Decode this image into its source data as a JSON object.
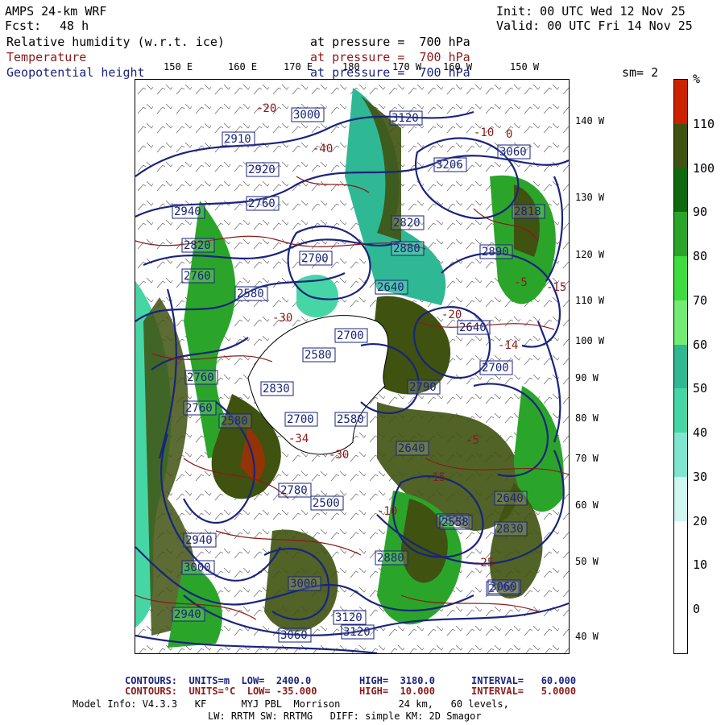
{
  "header": {
    "model": "AMPS 24-km WRF",
    "fcst_label": "Fcst:",
    "fcst_value": "48 h",
    "init": "Init: 00 UTC Wed 12 Nov 25",
    "valid": "Valid: 00 UTC Fri 14 Nov 25"
  },
  "fields": [
    {
      "name": "Relative humidity (w.r.t. ice)",
      "level": "at pressure =  700 hPa",
      "color": "#000000"
    },
    {
      "name": "Temperature",
      "level": "at pressure =  700 hPa",
      "color": "#8b1a1a"
    },
    {
      "name": "Geopotential height",
      "level": "at pressure =  700 hPa",
      "color": "#1a237e"
    }
  ],
  "smoothing": "sm= 2",
  "lon_labels": [
    "150 E",
    "160 E",
    "170 E",
    "180",
    "170 W",
    "160 W",
    "150 W"
  ],
  "lat_labels": [
    "140 W",
    "130 W",
    "120 W",
    "110 W",
    "100 W",
    "90 W",
    "80 W",
    "70 W",
    "60 W",
    "50 W",
    "40 W"
  ],
  "legend": {
    "unit": "%",
    "labels": [
      "110",
      "100",
      "90",
      "80",
      "70",
      "60",
      "50",
      "40",
      "30",
      "20",
      "10",
      "0"
    ],
    "colors": [
      "#cc2200",
      "#3f5210",
      "#0d6b0d",
      "#2aa52a",
      "#3fdc3f",
      "#73ec73",
      "#2fb894",
      "#46d6a6",
      "#7ee6d0",
      "#cff7f0",
      "#ffffff",
      "#ffffff",
      "#ffffff"
    ]
  },
  "map": {
    "height_labels": [
      "3000",
      "3120",
      "2910",
      "2920",
      "3206",
      "3060",
      "2940",
      "2760",
      "2818",
      "2820",
      "2880",
      "2890",
      "2700",
      "2820",
      "2640",
      "2580",
      "2760",
      "2700",
      "2580",
      "2640",
      "2760",
      "2830",
      "2790",
      "2700",
      "2580",
      "2580",
      "2640",
      "2700",
      "2760",
      "2780",
      "2500",
      "2820",
      "2640",
      "2558",
      "2830",
      "2940",
      "2700",
      "2880",
      "3000",
      "3000",
      "2940",
      "3060",
      "3120",
      "3060",
      "3120"
    ],
    "temp_labels": [
      "-20",
      "-10",
      "-30",
      "-15",
      "-14",
      "-34",
      "-30",
      "-25",
      "-5",
      "-15",
      "0",
      "-5",
      "-20",
      "-40",
      "-10"
    ],
    "colors": {
      "land": "#ffffff",
      "coast": "#000000",
      "height": "#1a237e",
      "temp": "#8b1a1a"
    }
  },
  "footer": {
    "line1_a": "CONTOURS:  UNITS=m  LOW=  2400.0",
    "line1_b": "HIGH=  3180.0",
    "line1_c": "INTERVAL=   60.000",
    "line2_a": "CONTOURS:  UNITS=°C  LOW= -35.000",
    "line2_b": "HIGH=  10.000",
    "line2_c": "INTERVAL=   5.0000",
    "model_info": "Model Info: V4.3.3   KF      MYJ PBL  Morrison          24 km,   60 levels,",
    "physics": "LW: RRTM SW: RRTMG   DIFF: simple KM: 2D Smagor"
  }
}
